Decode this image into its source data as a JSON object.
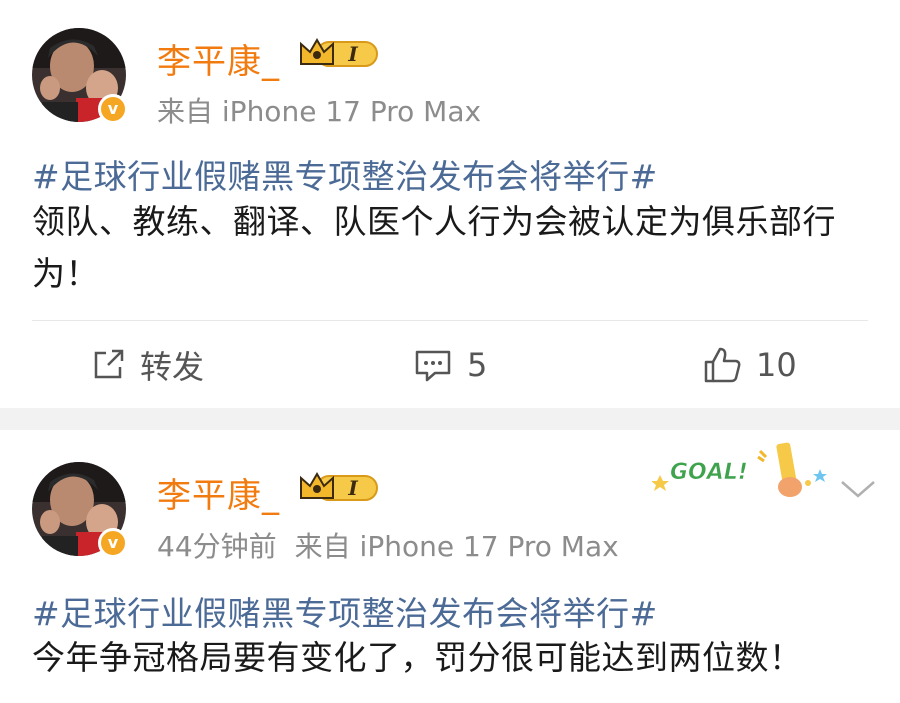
{
  "posts": [
    {
      "username": "李平康_",
      "level_badge": "I",
      "verified_badge": "v",
      "time": "",
      "source": "来自 iPhone 17 Pro Max",
      "topic": "#足球行业假赌黑专项整治发布会将举行#",
      "text": "领队、教练、翻译、队医个人行为会被认定为俱乐部行为！",
      "actions": {
        "repost_label": "转发",
        "comment_count": "5",
        "like_count": "10"
      }
    },
    {
      "username": "李平康_",
      "level_badge": "I",
      "verified_badge": "v",
      "time": "44分钟前",
      "source": "来自 iPhone 17 Pro Max",
      "topic": "#足球行业假赌黑专项整治发布会将举行#",
      "text": "今年争冠格局要有变化了，罚分很可能达到两位数！",
      "sticker_text": "GOAL!"
    }
  ],
  "icons": {
    "repost": "repost-icon",
    "comment": "comment-icon",
    "like": "thumbs-up-icon",
    "more": "chevron-down-icon",
    "crown": "crown-icon"
  },
  "colors": {
    "username": "#f27b0f",
    "topic": "#4b6a96",
    "meta": "#8c8c8c",
    "verified": "#f5a623",
    "band": "#f2f2f2"
  }
}
